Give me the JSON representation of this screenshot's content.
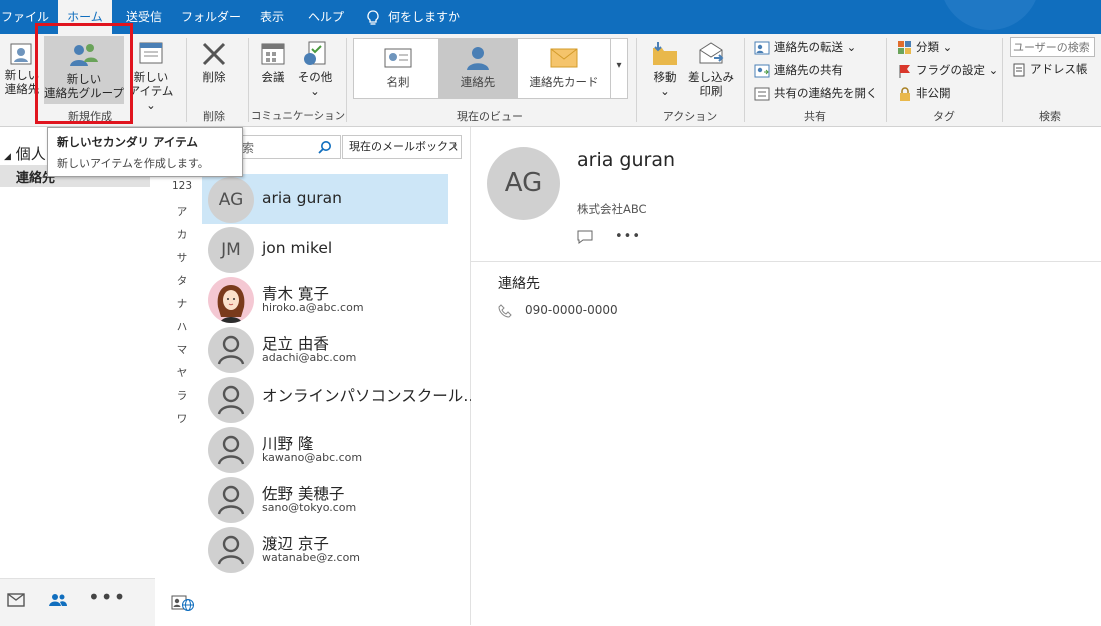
{
  "menu": {
    "tabs": [
      "ファイル",
      "ホーム",
      "送受信",
      "フォルダー",
      "表示",
      "ヘルプ"
    ],
    "active": "ホーム",
    "tell_me": "何をしますか"
  },
  "ribbon": {
    "new_group": {
      "new_contact_l1": "新しい",
      "new_contact_l2": "連絡先",
      "new_group_l1": "新しい",
      "new_group_l2": "連絡先グループ",
      "new_item_l1": "新しい",
      "new_item_l2": "アイテム",
      "label": "新規作成"
    },
    "delete_group": {
      "delete": "削除",
      "label": "削除"
    },
    "comm_group": {
      "meeting": "会議",
      "more": "その他",
      "label": "コミュニケーション"
    },
    "view_group": {
      "business_card": "名刺",
      "contact": "連絡先",
      "contact_card": "連絡先カード",
      "label": "現在のビュー"
    },
    "action_group": {
      "move": "移動",
      "merge_l1": "差し込み",
      "merge_l2": "印刷",
      "label": "アクション"
    },
    "share_group": {
      "forward": "連絡先の転送",
      "share": "連絡先の共有",
      "open_shared": "共有の連絡先を開く",
      "label": "共有"
    },
    "tags_group": {
      "categorize": "分類",
      "follow_up": "フラグの設定",
      "private": "非公開",
      "label": "タグ"
    },
    "find_group": {
      "search_people_placeholder": "ユーザーの検索",
      "address_book": "アドレス帳",
      "label": "検索"
    }
  },
  "tooltip": {
    "title": "新しいセカンダリ アイテム",
    "desc": "新しいアイテムを作成します。"
  },
  "leftnav": {
    "section": "個人",
    "item": "連絡先"
  },
  "list": {
    "search_placeholder": "索",
    "scope": "現在のメールボックス",
    "letters": [
      "123",
      "ア",
      "カ",
      "サ",
      "タ",
      "ナ",
      "ハ",
      "マ",
      "ヤ",
      "ラ",
      "ワ"
    ],
    "contacts": [
      {
        "initials": "AG",
        "name": "aria guran",
        "email": ""
      },
      {
        "initials": "JM",
        "name": "jon mikel",
        "email": ""
      },
      {
        "initials": "",
        "name": "青木 寛子",
        "email": "hiroko.a@abc.com"
      },
      {
        "initials": "",
        "name": "足立 由香",
        "email": "adachi@abc.com"
      },
      {
        "initials": "",
        "name": "オンラインパソコンスクール…",
        "email": ""
      },
      {
        "initials": "",
        "name": "川野 隆",
        "email": "kawano@abc.com"
      },
      {
        "initials": "",
        "name": "佐野 美穂子",
        "email": "sano@tokyo.com"
      },
      {
        "initials": "",
        "name": "渡辺 京子",
        "email": "watanabe@z.com"
      }
    ]
  },
  "detail": {
    "initials": "AG",
    "name": "aria guran",
    "company": "株式会社ABC",
    "section": "連絡先",
    "phone": "090-0000-0000"
  },
  "colors": {
    "accent": "#106ebe",
    "selection": "#cde6f7",
    "highlight_box": "#e0141e"
  }
}
